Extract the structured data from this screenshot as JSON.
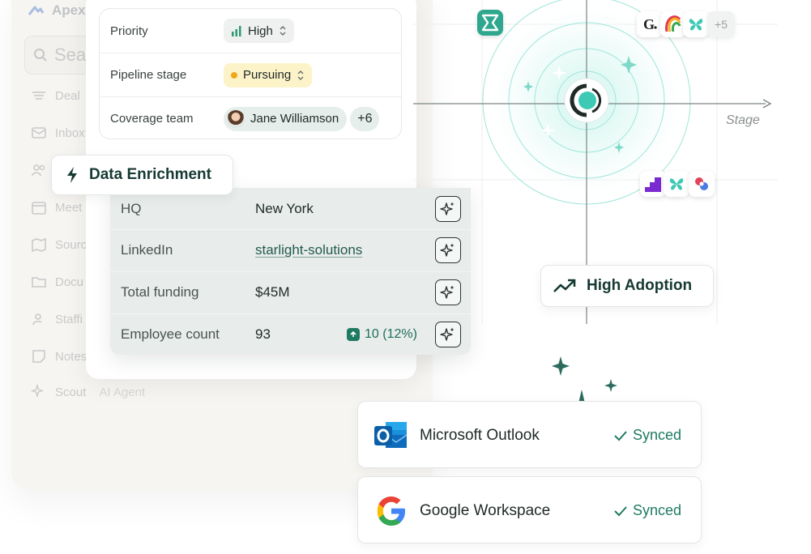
{
  "background_app": {
    "brand": "Apex",
    "search_placeholder": "Sea",
    "nav": [
      {
        "label": "Deal",
        "icon": "list-icon"
      },
      {
        "label": "Inbox",
        "icon": "mail-icon"
      },
      {
        "label": "",
        "icon": "people-icon"
      },
      {
        "label": "Meet",
        "icon": "calendar-icon"
      },
      {
        "label": "Sourc",
        "icon": "map-icon"
      },
      {
        "label": "Docu",
        "icon": "folder-icon"
      },
      {
        "label": "Staffi",
        "icon": "staffing-icon"
      },
      {
        "label": "Notes",
        "icon": "note-icon"
      },
      {
        "label": "Scout",
        "sublabel": "AI Agent",
        "icon": "sparkle-icon"
      }
    ]
  },
  "deal_fields": {
    "priority": {
      "label": "Priority",
      "value": "High"
    },
    "pipeline_stage": {
      "label": "Pipeline stage",
      "value": "Pursuing"
    },
    "coverage_team": {
      "label": "Coverage team",
      "value": "Jane Williamson",
      "extra": "+6"
    }
  },
  "enrichment": {
    "title": "Data Enrichment",
    "rows": [
      {
        "label": "HQ",
        "value": "New York"
      },
      {
        "label": "LinkedIn",
        "value": "starlight-solutions"
      },
      {
        "label": "Total funding",
        "value": "$45M"
      },
      {
        "label": "Employee count",
        "value": "93",
        "delta": "10 (12%)"
      }
    ]
  },
  "radar": {
    "axis_label": "Stage",
    "more_logos": "+5"
  },
  "adoption": {
    "label": "High Adoption"
  },
  "integrations": [
    {
      "name": "Microsoft Outlook",
      "status": "Synced"
    },
    {
      "name": "Google Workspace",
      "status": "Synced"
    }
  ],
  "colors": {
    "accent_green": "#1f7a62",
    "teal": "#3ec9b4",
    "dark_green": "#163a33"
  }
}
